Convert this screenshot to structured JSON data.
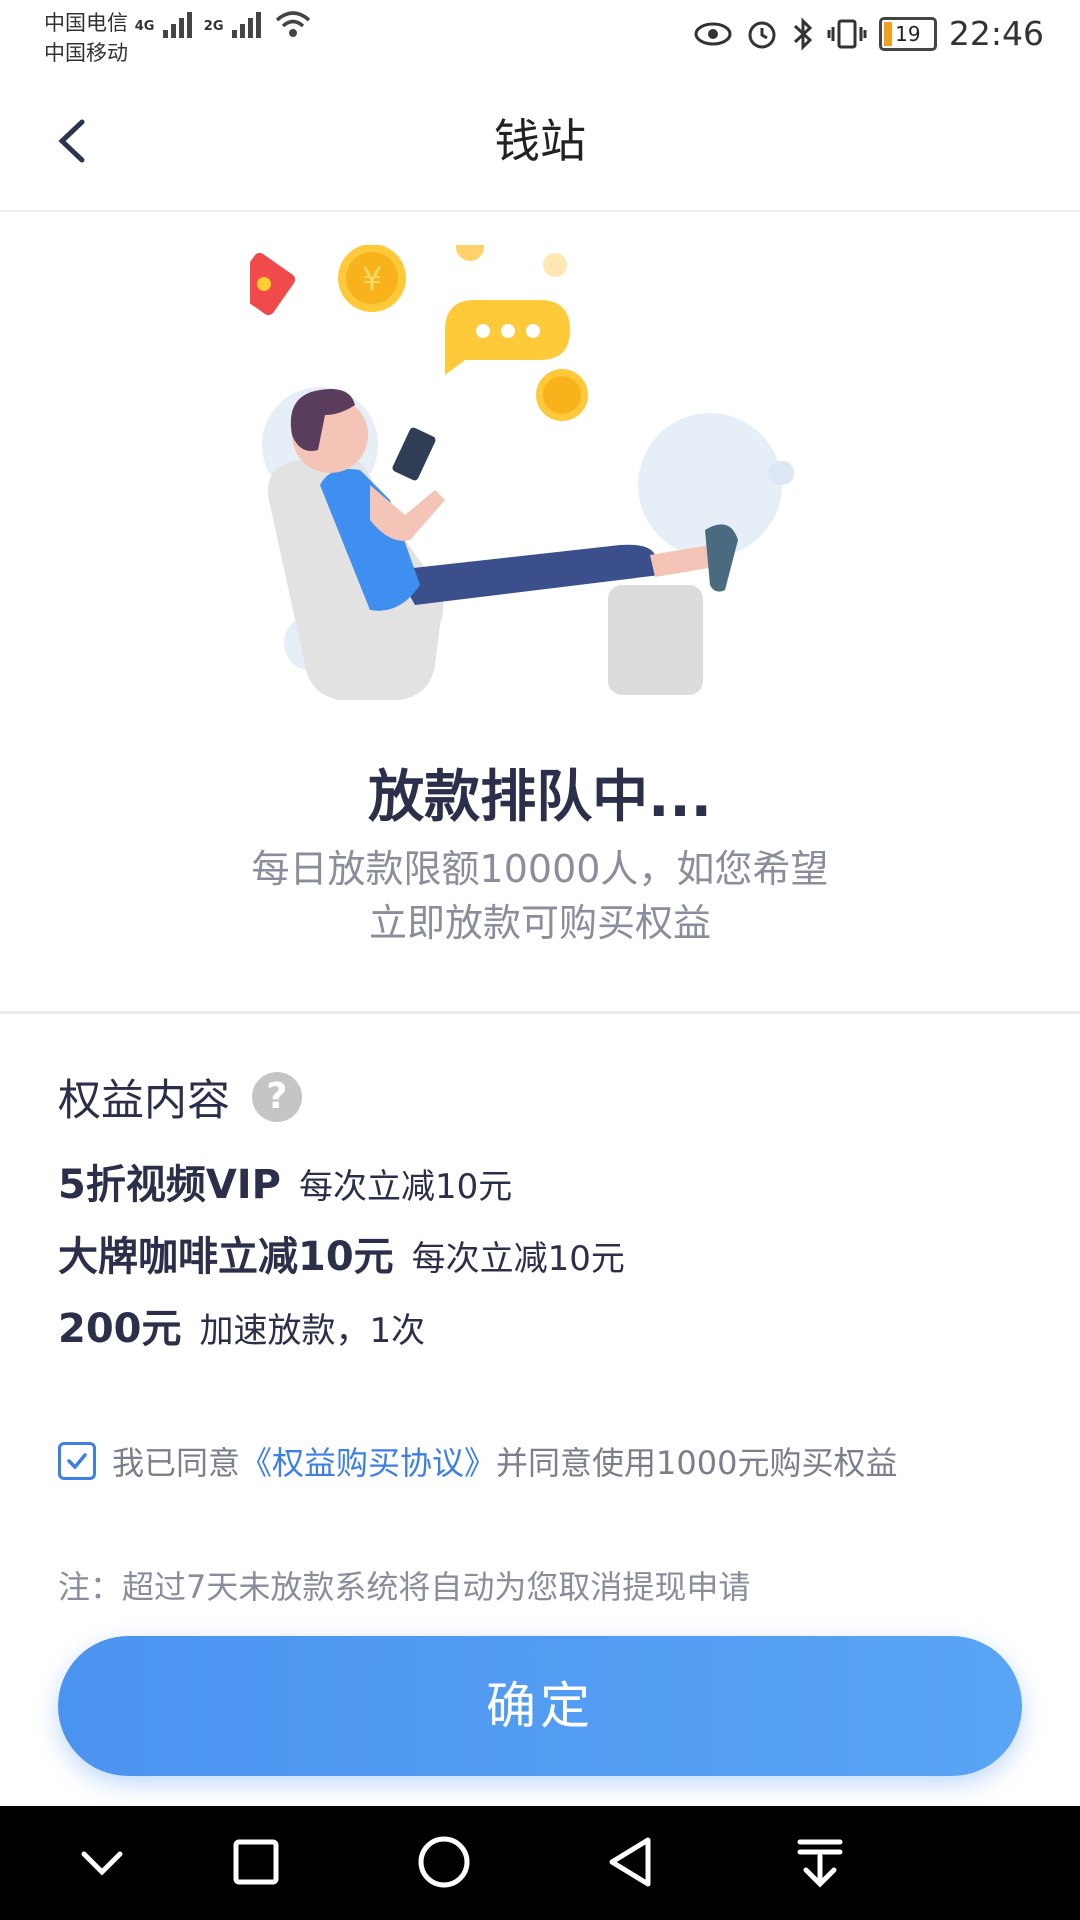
{
  "status_bar": {
    "carrier1": "中国电信",
    "carrier2": "中国移动",
    "net1": "4G",
    "net2": "2G",
    "battery": "19",
    "time": "22:46"
  },
  "nav": {
    "title": "钱站"
  },
  "queue": {
    "title": "放款排队中...",
    "desc_line1": "每日放款限额10000人，如您希望",
    "desc_line2": "立即放款可购买权益"
  },
  "benefits": {
    "section_title": "权益内容",
    "items": [
      {
        "main": "5折视频VIP",
        "sub": "每次立减10元"
      },
      {
        "main": "大牌咖啡立减10元",
        "sub": "每次立减10元"
      },
      {
        "main": "200元",
        "sub": "加速放款，1次"
      }
    ]
  },
  "agreement": {
    "prefix": "我已同意",
    "link": "《权益购买协议》",
    "suffix": "并同意使用1000元购买权益",
    "checked": true
  },
  "note": "注：超过7天未放款系统将自动为您取消提现申请",
  "confirm_label": "确定",
  "colors": {
    "accent": "#3e7fe6",
    "button": "#4b93f0",
    "title": "#2b2f4a",
    "muted": "#8a8e9c"
  }
}
